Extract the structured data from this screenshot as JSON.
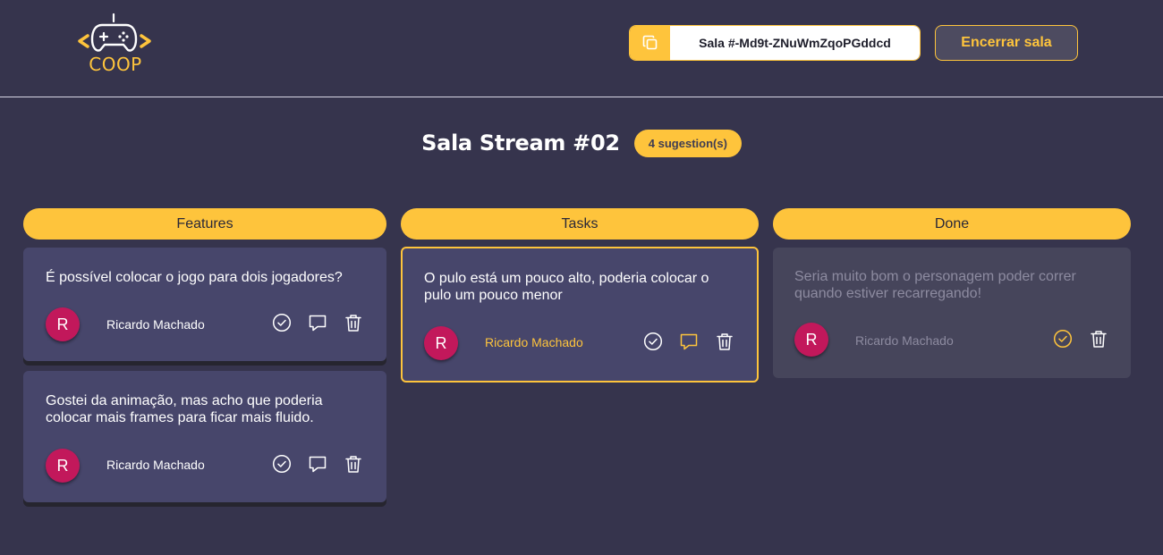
{
  "header": {
    "logo_text": "COOP",
    "room_code": "Sala #-Md9t-ZNuWmZqoPGddcd",
    "close_button": "Encerrar sala"
  },
  "page": {
    "title": "Sala Stream #02",
    "badge": "4 sugestion(s)"
  },
  "columns": [
    {
      "title": "Features",
      "cards": [
        {
          "text": "É possível colocar o jogo para dois jogadores?",
          "avatar": "R",
          "author": "Ricardo Machado"
        },
        {
          "text": "Gostei da animação, mas acho que poderia colocar mais frames para ficar mais fluido.",
          "avatar": "R",
          "author": "Ricardo Machado"
        }
      ]
    },
    {
      "title": "Tasks",
      "cards": [
        {
          "text": "O pulo está um pouco alto, poderia colocar o pulo um pouco menor",
          "avatar": "R",
          "author": "Ricardo Machado"
        }
      ]
    },
    {
      "title": "Done",
      "cards": [
        {
          "text": "Seria muito bom o personagem poder correr quando estiver recarregando!",
          "avatar": "R",
          "author": "Ricardo Machado"
        }
      ]
    }
  ],
  "icons": {
    "copy": "copy-icon",
    "check": "check-circle-icon",
    "comment": "comment-icon",
    "trash": "trash-icon"
  },
  "colors": {
    "background": "#36344d",
    "accent": "#fec43c",
    "card": "#47466b",
    "avatar": "#c2185b"
  }
}
